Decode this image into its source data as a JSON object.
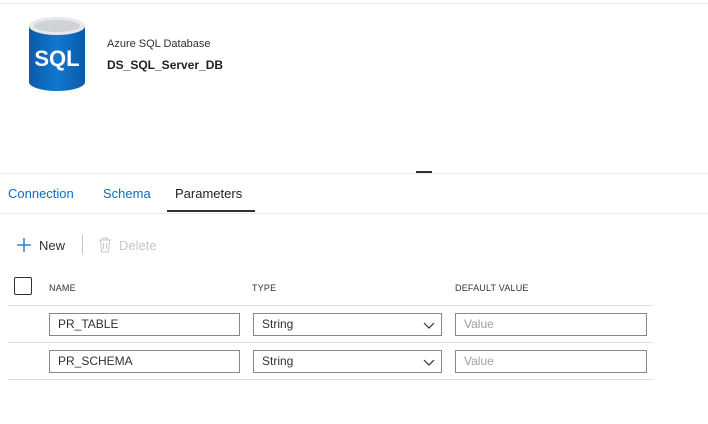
{
  "header": {
    "icon_label": "SQL",
    "db_type": "Azure SQL Database",
    "db_name": "DS_SQL_Server_DB"
  },
  "tabs": [
    {
      "label": "Connection",
      "active": false
    },
    {
      "label": "Schema",
      "active": false
    },
    {
      "label": "Parameters",
      "active": true
    }
  ],
  "toolbar": {
    "new_label": "New",
    "delete_label": "Delete"
  },
  "table": {
    "columns": [
      "NAME",
      "TYPE",
      "DEFAULT VALUE"
    ],
    "rows": [
      {
        "name": "PR_TABLE",
        "type": "String",
        "default_placeholder": "Value"
      },
      {
        "name": "PR_SCHEMA",
        "type": "String",
        "default_placeholder": "Value"
      }
    ]
  },
  "colors": {
    "accent": "#0f6cbd",
    "sql_icon": "#0f6cbd",
    "text": "#323130",
    "disabled": "#c8c6c4"
  },
  "icons": [
    "sql-database-icon",
    "add-icon",
    "delete-icon",
    "chevron-down-icon"
  ]
}
